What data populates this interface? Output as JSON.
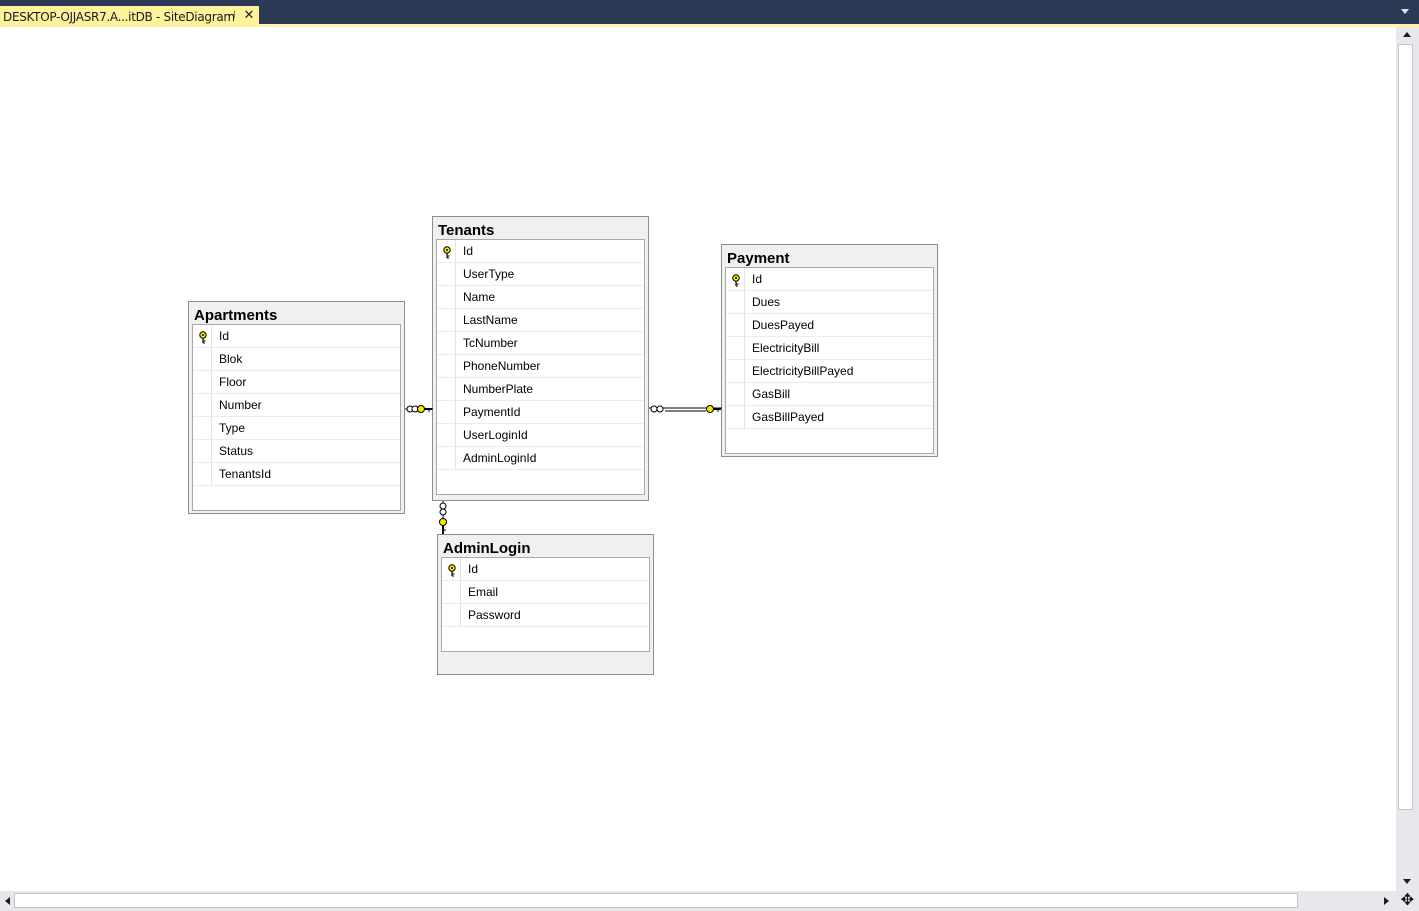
{
  "tab": {
    "title": "DESKTOP-OJJASR7.A...itDB - SiteDiagram",
    "pin_icon": "pin-icon",
    "close_icon": "close-icon"
  },
  "colors": {
    "tab_bar": "#2d3a56",
    "tab_active": "#fff29d",
    "key_icon": "#f4e800",
    "relation_line": "#000000"
  },
  "tables": {
    "apartments": {
      "name": "Apartments",
      "columns": [
        "Id",
        "Blok",
        "Floor",
        "Number",
        "Type",
        "Status",
        "TenantsId"
      ],
      "primary_key": "Id"
    },
    "tenants": {
      "name": "Tenants",
      "columns": [
        "Id",
        "UserType",
        "Name",
        "LastName",
        "TcNumber",
        "PhoneNumber",
        "NumberPlate",
        "PaymentId",
        "UserLoginId",
        "AdminLoginId"
      ],
      "primary_key": "Id"
    },
    "payment": {
      "name": "Payment",
      "columns": [
        "Id",
        "Dues",
        "DuesPayed",
        "ElectricityBill",
        "ElectricityBillPayed",
        "GasBill",
        "GasBillPayed"
      ],
      "primary_key": "Id"
    },
    "adminlogin": {
      "name": "AdminLogin",
      "columns": [
        "Id",
        "Email",
        "Password"
      ],
      "primary_key": "Id"
    }
  },
  "relationships": [
    {
      "from": "Apartments",
      "to": "Tenants",
      "many_end": "Apartments",
      "key_end": "Tenants"
    },
    {
      "from": "Tenants",
      "to": "Payment",
      "many_end": "Tenants",
      "key_end": "Payment"
    },
    {
      "from": "Tenants",
      "to": "AdminLogin",
      "many_end": "Tenants",
      "key_end": "AdminLogin"
    }
  ]
}
